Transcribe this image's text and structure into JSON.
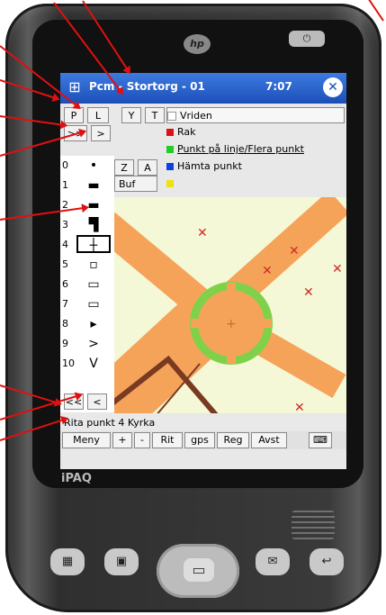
{
  "window": {
    "title": "Pcm - Stortorg - 01",
    "status": "7:07",
    "ok_label": "✕"
  },
  "device": {
    "logo": "hp",
    "power_label": "⏻",
    "brand": "iPAQ"
  },
  "toolbar": {
    "row1": [
      "P",
      "L",
      "Y",
      "T"
    ],
    "row2": [
      ">>",
      ">"
    ],
    "row3": [
      "Z",
      "A"
    ],
    "buf_label": "Buf"
  },
  "layers": [
    {
      "label": "Vriden",
      "color": "#ffffff"
    },
    {
      "label": "Rak",
      "color": "#e01010"
    },
    {
      "label": "Punkt på linje/Flera punkt",
      "color": "#22cc22"
    },
    {
      "label": "Hämta punkt",
      "color": "#1040e0"
    },
    {
      "label": "",
      "color": "#f0e010"
    }
  ],
  "symbols": [
    {
      "num": "0",
      "sym": "•"
    },
    {
      "num": "1",
      "sym": "▬"
    },
    {
      "num": "2",
      "sym": "▬"
    },
    {
      "num": "3",
      "sym": "▜"
    },
    {
      "num": "4",
      "sym": "┼"
    },
    {
      "num": "5",
      "sym": "▫"
    },
    {
      "num": "6",
      "sym": "▭"
    },
    {
      "num": "7",
      "sym": "▭"
    },
    {
      "num": "8",
      "sym": "▸"
    },
    {
      "num": "9",
      "sym": ">"
    },
    {
      "num": "10",
      "sym": "V"
    }
  ],
  "nav": {
    "back_all": "<<",
    "back": "<"
  },
  "status_line": "Rita punkt 4 Kyrka",
  "menu": [
    "Meny",
    "+",
    "-",
    "Rit",
    "gps",
    "Reg",
    "Avst"
  ],
  "keyboard_icon": "⌨",
  "map": {
    "marker_count": 6
  },
  "colors": {
    "accent": "#e01010",
    "road": "#f6a35a",
    "circle": "#7fd14a",
    "title": "#1c4fb8"
  }
}
